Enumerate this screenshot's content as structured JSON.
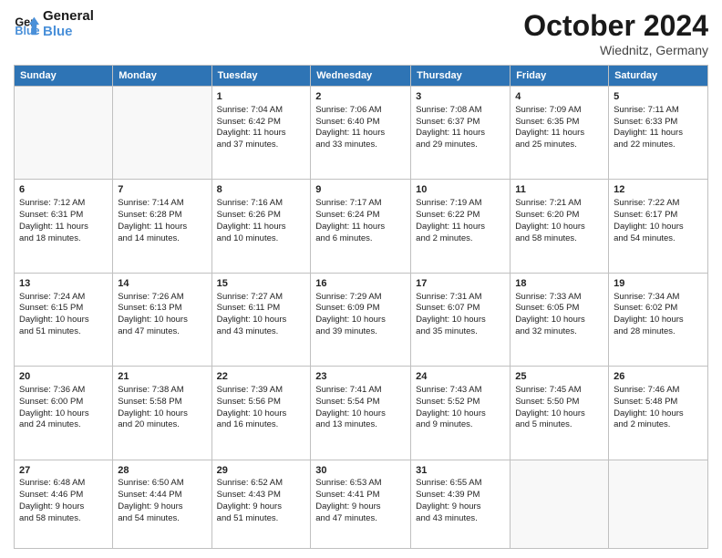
{
  "header": {
    "logo_line1": "General",
    "logo_line2": "Blue",
    "month": "October 2024",
    "location": "Wiednitz, Germany"
  },
  "weekdays": [
    "Sunday",
    "Monday",
    "Tuesday",
    "Wednesday",
    "Thursday",
    "Friday",
    "Saturday"
  ],
  "weeks": [
    [
      {
        "day": "",
        "info": ""
      },
      {
        "day": "",
        "info": ""
      },
      {
        "day": "1",
        "info": "Sunrise: 7:04 AM\nSunset: 6:42 PM\nDaylight: 11 hours\nand 37 minutes."
      },
      {
        "day": "2",
        "info": "Sunrise: 7:06 AM\nSunset: 6:40 PM\nDaylight: 11 hours\nand 33 minutes."
      },
      {
        "day": "3",
        "info": "Sunrise: 7:08 AM\nSunset: 6:37 PM\nDaylight: 11 hours\nand 29 minutes."
      },
      {
        "day": "4",
        "info": "Sunrise: 7:09 AM\nSunset: 6:35 PM\nDaylight: 11 hours\nand 25 minutes."
      },
      {
        "day": "5",
        "info": "Sunrise: 7:11 AM\nSunset: 6:33 PM\nDaylight: 11 hours\nand 22 minutes."
      }
    ],
    [
      {
        "day": "6",
        "info": "Sunrise: 7:12 AM\nSunset: 6:31 PM\nDaylight: 11 hours\nand 18 minutes."
      },
      {
        "day": "7",
        "info": "Sunrise: 7:14 AM\nSunset: 6:28 PM\nDaylight: 11 hours\nand 14 minutes."
      },
      {
        "day": "8",
        "info": "Sunrise: 7:16 AM\nSunset: 6:26 PM\nDaylight: 11 hours\nand 10 minutes."
      },
      {
        "day": "9",
        "info": "Sunrise: 7:17 AM\nSunset: 6:24 PM\nDaylight: 11 hours\nand 6 minutes."
      },
      {
        "day": "10",
        "info": "Sunrise: 7:19 AM\nSunset: 6:22 PM\nDaylight: 11 hours\nand 2 minutes."
      },
      {
        "day": "11",
        "info": "Sunrise: 7:21 AM\nSunset: 6:20 PM\nDaylight: 10 hours\nand 58 minutes."
      },
      {
        "day": "12",
        "info": "Sunrise: 7:22 AM\nSunset: 6:17 PM\nDaylight: 10 hours\nand 54 minutes."
      }
    ],
    [
      {
        "day": "13",
        "info": "Sunrise: 7:24 AM\nSunset: 6:15 PM\nDaylight: 10 hours\nand 51 minutes."
      },
      {
        "day": "14",
        "info": "Sunrise: 7:26 AM\nSunset: 6:13 PM\nDaylight: 10 hours\nand 47 minutes."
      },
      {
        "day": "15",
        "info": "Sunrise: 7:27 AM\nSunset: 6:11 PM\nDaylight: 10 hours\nand 43 minutes."
      },
      {
        "day": "16",
        "info": "Sunrise: 7:29 AM\nSunset: 6:09 PM\nDaylight: 10 hours\nand 39 minutes."
      },
      {
        "day": "17",
        "info": "Sunrise: 7:31 AM\nSunset: 6:07 PM\nDaylight: 10 hours\nand 35 minutes."
      },
      {
        "day": "18",
        "info": "Sunrise: 7:33 AM\nSunset: 6:05 PM\nDaylight: 10 hours\nand 32 minutes."
      },
      {
        "day": "19",
        "info": "Sunrise: 7:34 AM\nSunset: 6:02 PM\nDaylight: 10 hours\nand 28 minutes."
      }
    ],
    [
      {
        "day": "20",
        "info": "Sunrise: 7:36 AM\nSunset: 6:00 PM\nDaylight: 10 hours\nand 24 minutes."
      },
      {
        "day": "21",
        "info": "Sunrise: 7:38 AM\nSunset: 5:58 PM\nDaylight: 10 hours\nand 20 minutes."
      },
      {
        "day": "22",
        "info": "Sunrise: 7:39 AM\nSunset: 5:56 PM\nDaylight: 10 hours\nand 16 minutes."
      },
      {
        "day": "23",
        "info": "Sunrise: 7:41 AM\nSunset: 5:54 PM\nDaylight: 10 hours\nand 13 minutes."
      },
      {
        "day": "24",
        "info": "Sunrise: 7:43 AM\nSunset: 5:52 PM\nDaylight: 10 hours\nand 9 minutes."
      },
      {
        "day": "25",
        "info": "Sunrise: 7:45 AM\nSunset: 5:50 PM\nDaylight: 10 hours\nand 5 minutes."
      },
      {
        "day": "26",
        "info": "Sunrise: 7:46 AM\nSunset: 5:48 PM\nDaylight: 10 hours\nand 2 minutes."
      }
    ],
    [
      {
        "day": "27",
        "info": "Sunrise: 6:48 AM\nSunset: 4:46 PM\nDaylight: 9 hours\nand 58 minutes."
      },
      {
        "day": "28",
        "info": "Sunrise: 6:50 AM\nSunset: 4:44 PM\nDaylight: 9 hours\nand 54 minutes."
      },
      {
        "day": "29",
        "info": "Sunrise: 6:52 AM\nSunset: 4:43 PM\nDaylight: 9 hours\nand 51 minutes."
      },
      {
        "day": "30",
        "info": "Sunrise: 6:53 AM\nSunset: 4:41 PM\nDaylight: 9 hours\nand 47 minutes."
      },
      {
        "day": "31",
        "info": "Sunrise: 6:55 AM\nSunset: 4:39 PM\nDaylight: 9 hours\nand 43 minutes."
      },
      {
        "day": "",
        "info": ""
      },
      {
        "day": "",
        "info": ""
      }
    ]
  ]
}
